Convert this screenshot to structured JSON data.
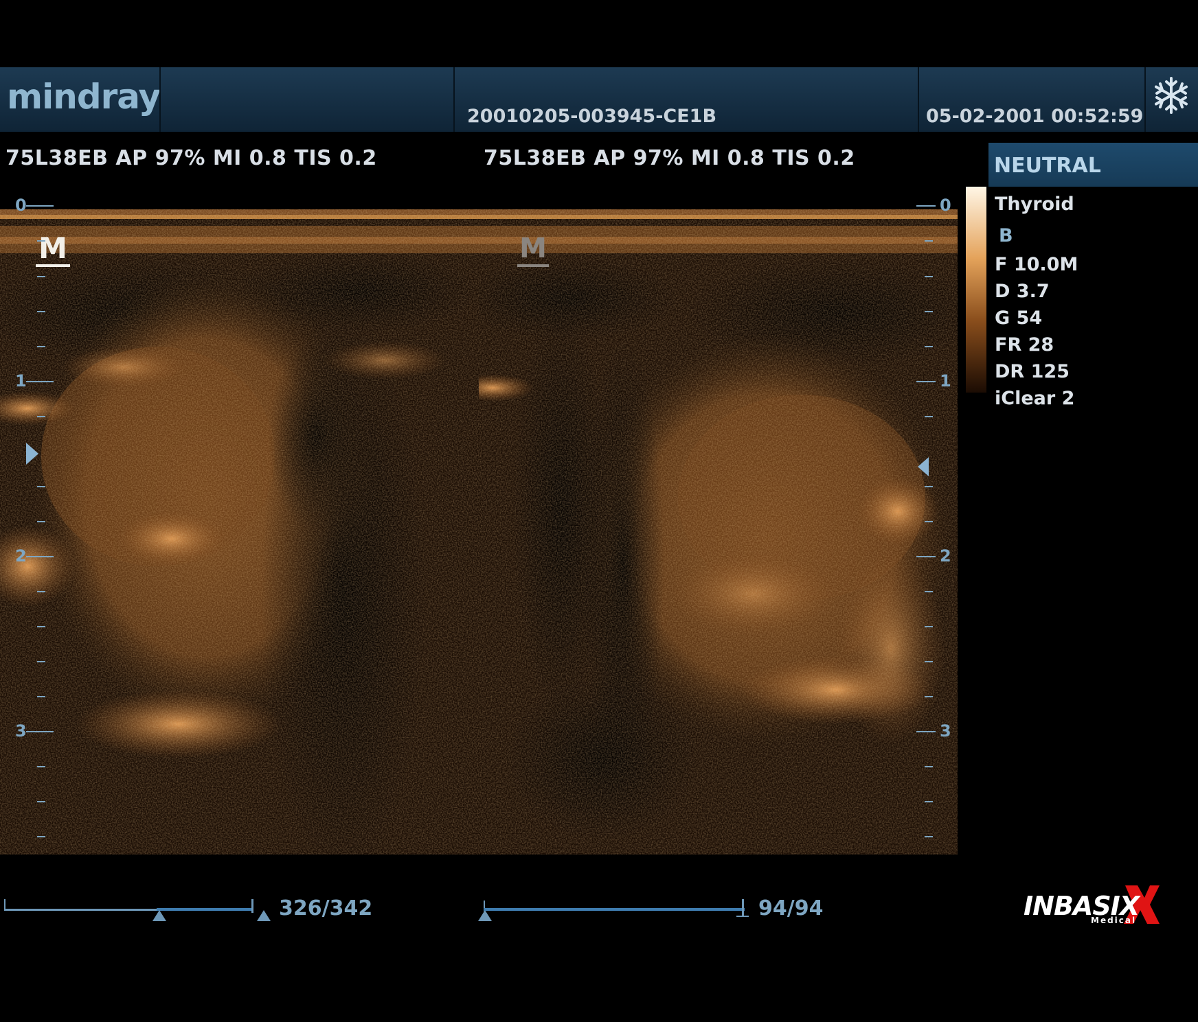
{
  "header": {
    "brand": "mindray",
    "patient_id": "20010205-003945-CE1B",
    "datetime": "05-02-2001 00:52:59",
    "freeze_icon": "snowflake-icon"
  },
  "left_image": {
    "acq_info": "75L38EB  AP 97%  MI 0.8 TIS 0.2",
    "marker": "M",
    "depth_labels": [
      "0",
      "1",
      "2",
      "3"
    ],
    "cine_counter": "326/342"
  },
  "right_image": {
    "acq_info": "75L38EB  AP 97%  MI 0.8 TIS 0.2",
    "marker": "M",
    "depth_labels": [
      "0",
      "1",
      "2",
      "3"
    ],
    "cine_counter": "94/94"
  },
  "params": {
    "preset": "NEUTRAL",
    "exam": "Thyroid",
    "mode": "B",
    "frequency": "F 10.0M",
    "depth": "D 3.7",
    "gain": "G 54",
    "frame_rate": "FR 28",
    "dynamic_range": "DR 125",
    "iclear": "iClear 2"
  },
  "watermark": {
    "brand": "INBASIX",
    "sub": "Medical"
  },
  "colors": {
    "accent": "#7ea6c2",
    "echo": "#c8853f",
    "header": "#163247"
  }
}
